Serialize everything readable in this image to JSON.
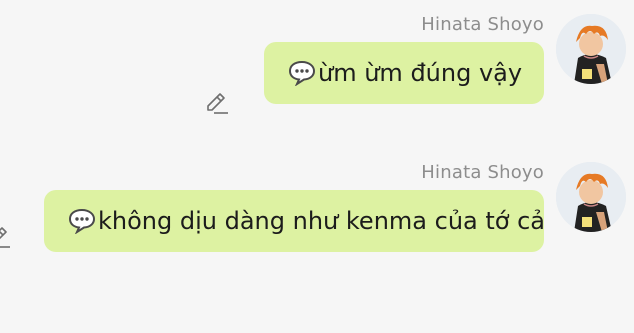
{
  "messages": [
    {
      "sender": "Hinata Shoyo",
      "text": "ừm ừm đúng vậy"
    },
    {
      "sender": "Hinata Shoyo",
      "text": "không dịu dàng như kenma của tớ cả"
    }
  ],
  "icons": {
    "bubble_prefix": "speech-balloon-icon",
    "edit": "pencil-edit-icon"
  },
  "colors": {
    "background": "#f6f6f6",
    "bubble": "#ddf2a2",
    "sender_name": "#8d8d8d",
    "text": "#1c1c1c"
  }
}
